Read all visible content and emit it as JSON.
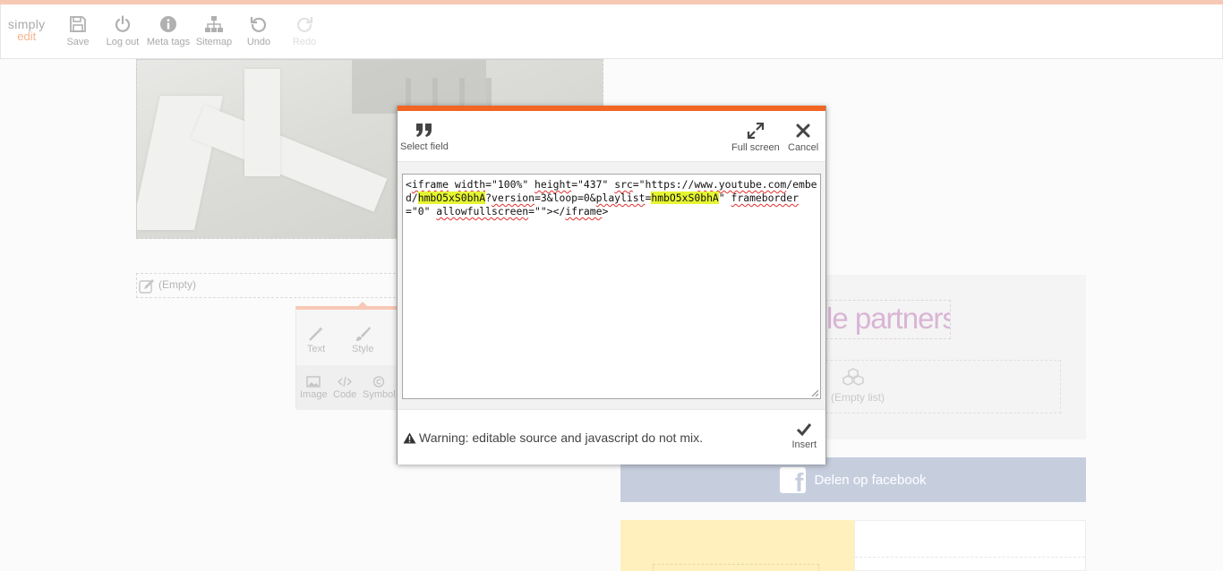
{
  "app": {
    "logo_top": "simply",
    "logo_bottom": "edit"
  },
  "toolbar": {
    "buttons": [
      {
        "label": "Save",
        "icon": "save-icon"
      },
      {
        "label": "Log out",
        "icon": "power-icon"
      },
      {
        "label": "Meta tags",
        "icon": "info-icon"
      },
      {
        "label": "Sitemap",
        "icon": "sitemap-icon"
      },
      {
        "label": "Undo",
        "icon": "undo-icon"
      },
      {
        "label": "Redo",
        "icon": "redo-icon",
        "disabled": true
      }
    ]
  },
  "page": {
    "empty_field_label": "(Empty)",
    "mini_toolbar": {
      "row1": [
        "Text",
        "Style"
      ],
      "row2": [
        "Image",
        "Code",
        "Symbol"
      ]
    },
    "partners_heading": "le partners",
    "empty_list_label": "(Empty list)",
    "facebook_button": "Delen op facebook"
  },
  "dialog": {
    "select_field_label": "Select field",
    "full_screen_label": "Full screen",
    "cancel_label": "Cancel",
    "source_code": "<iframe width=\"100%\" height=\"437\" src=\"https://www.youtube.com/embed/hmbO5xS0bhA?version=3&loop=0&playlist=hmbO5xS0bhA\" frameborder=\"0\" allowfullscreen=\"\"></iframe>",
    "warning_text": "Warning: editable source and javascript do not mix.",
    "insert_label": "Insert"
  },
  "colors": {
    "accent": "#f26522",
    "accent_light": "#f7c9b5",
    "facebook": "#c6cede",
    "highlight": "#e6f532"
  }
}
